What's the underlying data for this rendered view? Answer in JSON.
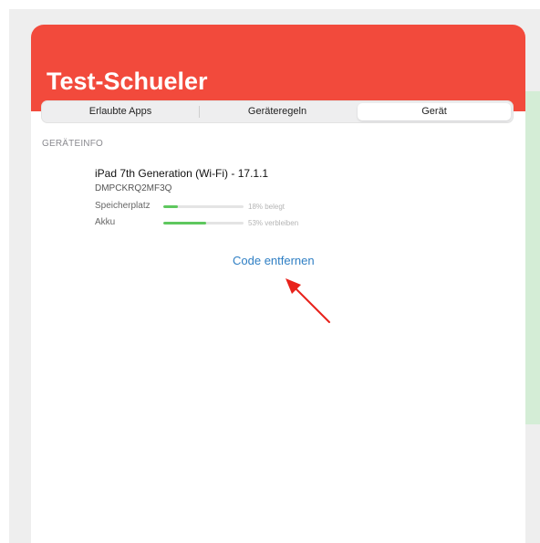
{
  "window": {
    "title": "Test-Schueler"
  },
  "tabs": [
    {
      "label": "Erlaubte Apps",
      "selected": false
    },
    {
      "label": "Geräteregeln",
      "selected": false
    },
    {
      "label": "Gerät",
      "selected": true
    }
  ],
  "device_info": {
    "section_title": "GERÄTEINFO",
    "device_name": "iPad 7th Generation (Wi-Fi) - 17.1.1",
    "serial": "DMPCKRQ2MF3Q",
    "storage": {
      "label": "Speicherplatz",
      "percent": 18,
      "text": "18% belegt"
    },
    "battery": {
      "label": "Akku",
      "percent": 53,
      "text": "53% verbleiben"
    },
    "remove_code_label": "Code entfernen"
  },
  "colors": {
    "header": "#f24a3c",
    "progress_fill": "#5ec75e",
    "link": "#2f7fc4",
    "annotation_arrow": "#e8221b"
  }
}
